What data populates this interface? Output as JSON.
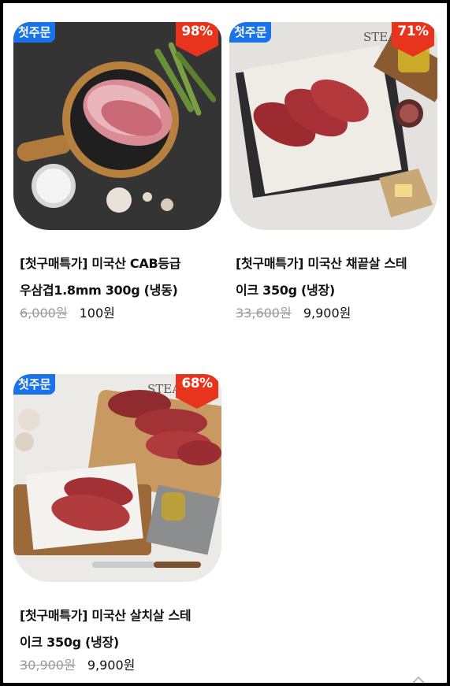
{
  "products": [
    {
      "first_order_badge": "첫주문",
      "discount": "98%",
      "name_line1": "[첫구매특가] 미국산 CAB등급",
      "name_line2": "우삼겹1.8mm 300g (냉동)",
      "original_price": "6,000원",
      "sale_price": "100원",
      "image_icon": "beef-brisket-image"
    },
    {
      "first_order_badge": "첫주문",
      "discount": "71%",
      "name_line1": "[첫구매특가] 미국산 채끝살 스테",
      "name_line2": "이크 350g (냉장)",
      "original_price": "33,600원",
      "sale_price": "9,900원",
      "image_icon": "striploin-steak-image",
      "image_text": "STEA"
    },
    {
      "first_order_badge": "첫주문",
      "discount": "68%",
      "name_line1": "[첫구매특가] 미국산 살치살 스테",
      "name_line2": "이크 350g (냉장)",
      "original_price": "30,900원",
      "sale_price": "9,900원",
      "image_icon": "chuck-flap-steak-image",
      "image_text": "STEA"
    }
  ],
  "colors": {
    "first_badge": "#1a73e8",
    "discount_badge": "#e8341c",
    "strike_price": "#999999"
  }
}
